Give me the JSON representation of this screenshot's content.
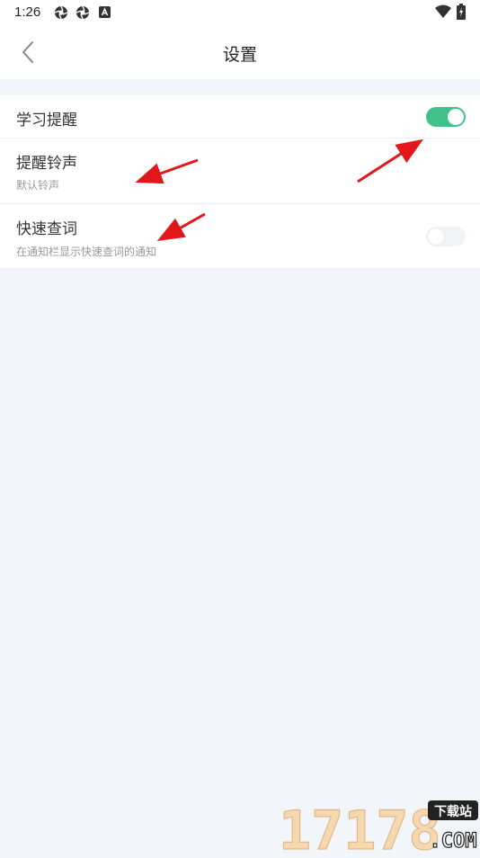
{
  "status_bar": {
    "time": "1:26"
  },
  "header": {
    "title": "设置"
  },
  "settings": {
    "items": [
      {
        "title": "学习提醒",
        "subtitle": "",
        "toggle_on": true
      },
      {
        "title": "提醒铃声",
        "subtitle": "默认铃声"
      },
      {
        "title": "快速查词",
        "subtitle": "在通知栏显示快速查词的通知",
        "toggle_on": false
      }
    ]
  },
  "colors": {
    "accent": "#43c18b",
    "background": "#f2f5f9",
    "annotation_arrow": "#e3161b"
  },
  "watermark": {
    "number": "17178",
    "tag": "下载站",
    "domain": ".COM"
  }
}
